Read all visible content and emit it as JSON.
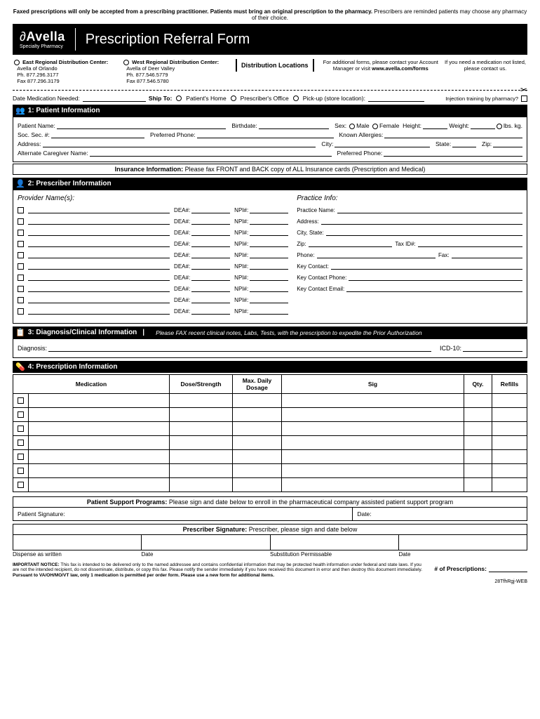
{
  "topWarning": {
    "bold": "Faxed prescriptions will only be accepted from a prescribing practitioner. Patients must bring an original prescription to the pharmacy.",
    "rest": " Prescribers are reminded patients may choose any pharmacy of their choice."
  },
  "logo": {
    "main": "Avella",
    "sub": "Specialty Pharmacy"
  },
  "title": "Prescription Referral Form",
  "dist": {
    "east": {
      "title": "East Regional Distribution Center:",
      "l1": "Avella of Orlando",
      "l2": "Ph. 877.296.3177",
      "l3": "Fax 877.296.3179"
    },
    "west": {
      "title": "West Regional Distribution Center:",
      "l1": "Avella of Deer Valley",
      "l2": "Ph. 877.546.5779",
      "l3": "Fax 877.546.5780"
    },
    "label": "Distribution Locations",
    "forms": "For additional forms, please contact your Account Manager or visit ",
    "formsUrl": "www.avella.com/forms",
    "needMed": "If you need a medication not listed, please contact us."
  },
  "dmn": {
    "dateLabel": "Date Medication Needed:",
    "shipTo": "Ship To:",
    "opt1": "Patient's Home",
    "opt2": "Prescriber's Office",
    "opt3": "Pick-up (store location):",
    "inj": "Injection training by pharmacy?"
  },
  "s1": {
    "title": "1: Patient Information",
    "patientName": "Patient Name:",
    "birthdate": "Birthdate:",
    "sex": "Sex:",
    "male": "Male",
    "female": "Female",
    "height": "Height:",
    "weight": "Weight:",
    "lbs": "lbs.",
    "kg": "kg.",
    "ssn": "Soc. Sec. #:",
    "prefPhone": "Preferred Phone:",
    "allergies": "Known Allergies:",
    "address": "Address:",
    "city": "City:",
    "state": "State:",
    "zip": "Zip:",
    "altCare": "Alternate Caregiver Name:",
    "prefPhone2": "Preferred Phone:"
  },
  "insBar": {
    "bold": "Insurance Information:",
    "rest": " Please fax FRONT and BACK copy of ALL Insurance cards (Prescription and Medical)"
  },
  "s2": {
    "title": "2: Prescriber Information",
    "provTitle": "Provider Name(s):",
    "pracTitle": "Practice Info:",
    "dea": "DEA#:",
    "npi": "NPI#:",
    "practiceName": "Practice Name:",
    "address": "Address:",
    "cityState": "City, State:",
    "zip": "Zip:",
    "taxId": "Tax ID#:",
    "phone": "Phone:",
    "fax": "Fax:",
    "keyContact": "Key Contact:",
    "keyPhone": "Key Contact Phone:",
    "keyEmail": "Key Contact Email:"
  },
  "s3": {
    "title": "3: Diagnosis/Clinical Information",
    "note": "Please FAX recent clinical notes, Labs, Tests, with the prescription to expedite the Prior Authorization",
    "diagnosis": "Diagnosis:",
    "icd": "ICD-10:"
  },
  "s4": {
    "title": "4: Prescription Information",
    "cols": {
      "med": "Medication",
      "dose": "Dose/Strength",
      "maxDose": "Max. Daily Dosage",
      "sig": "Sig",
      "qty": "Qty.",
      "refills": "Refills"
    }
  },
  "support": {
    "bold": "Patient Support Programs:",
    "rest": " Please sign and date below to enroll in the pharmaceutical company assisted patient support program"
  },
  "sig": {
    "patient": "Patient Signature:",
    "date": "Date:"
  },
  "prescSig": {
    "bold": "Prescriber Signature:",
    "rest": " Prescriber, please sign and date below"
  },
  "bottom": {
    "daw": "Dispense as written",
    "date": "Date",
    "sub": "Substitution Permissable",
    "date2": "Date"
  },
  "notice": {
    "bold1": "IMPORTANT NOTICE:",
    "text": " This fax is intended to be delivered only to the named addressee and contains confidential information that may be protected health information under federal and state laws. If you are not the intended recipient, do not disseminate, distribute, or copy this fax. Please notify the sender immediately if you have received this document in error and then destroy this document immediately.",
    "bold2": "Pursuant to VA/OH/MO/VT law, only 1 medication is permitted per order form. Please use a new form for additional items."
  },
  "numRx": "# of Prescriptions:",
  "formCode": "28TfhRgj-WEB"
}
